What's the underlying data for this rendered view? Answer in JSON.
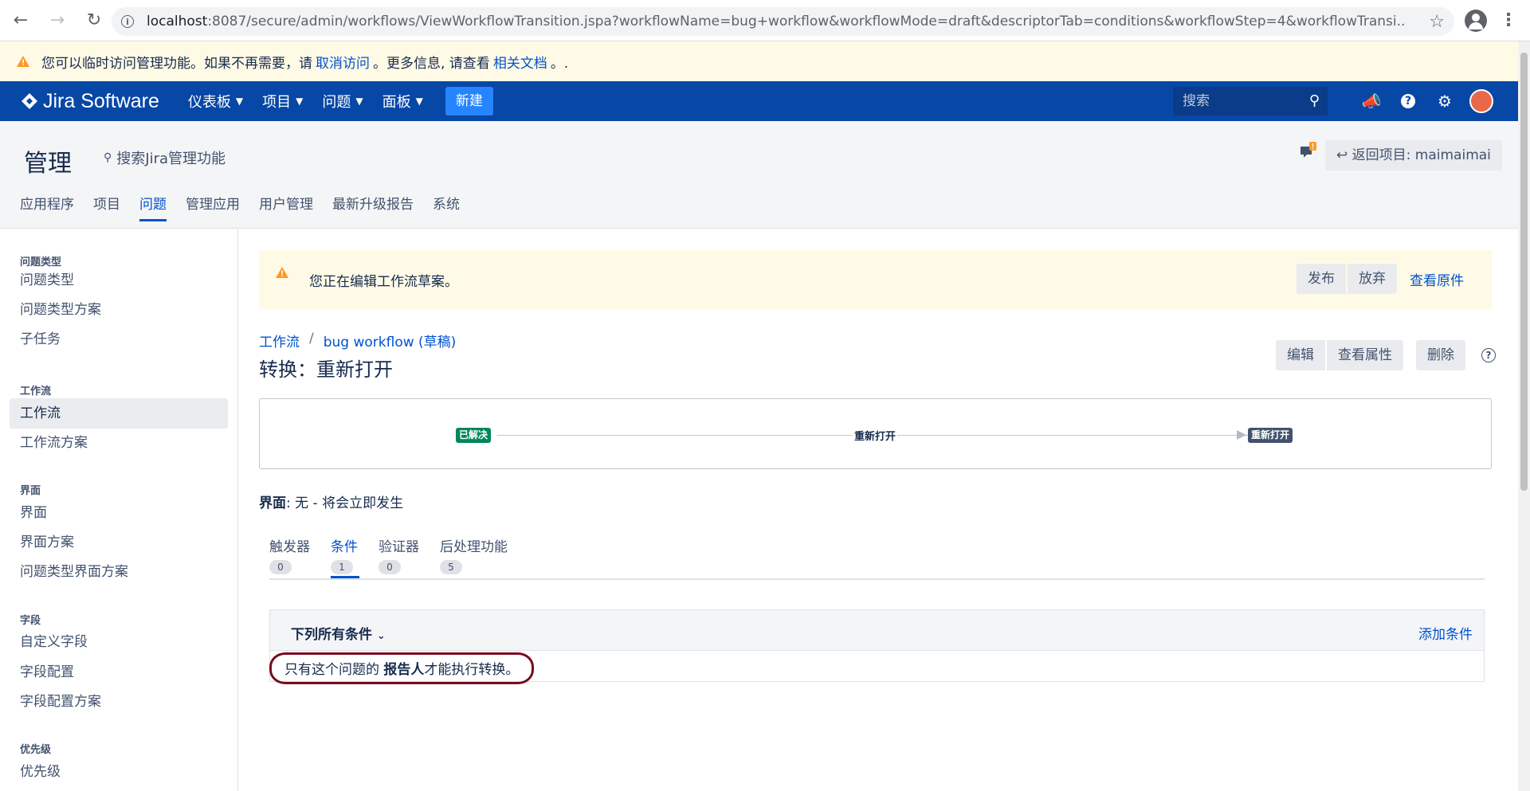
{
  "browser": {
    "url_host": "localhost",
    "url_rest": ":8087/secure/admin/workflows/ViewWorkflowTransition.jspa?workflowName=bug+workflow&workflowMode=draft&descriptorTab=conditions&workflowStep=4&workflowTransi..."
  },
  "banner": {
    "text_before": "您可以临时访问管理功能。如果不再需要，请",
    "link_cancel": "取消访问",
    "text_middle": "。更多信息, 请查看",
    "link_docs": "相关文档",
    "text_after": "。."
  },
  "header": {
    "logo": "Jira Software",
    "menu": [
      "仪表板",
      "项目",
      "问题",
      "面板"
    ],
    "create_label": "新建",
    "search_placeholder": "搜索"
  },
  "admin": {
    "title": "管理",
    "search_label": "搜索Jira管理功能",
    "back_button": "返回项目: maimaimai",
    "tabs": [
      "应用程序",
      "项目",
      "问题",
      "管理应用",
      "用户管理",
      "最新升级报告",
      "系统"
    ],
    "active_tab": "问题"
  },
  "sidebar": {
    "sections": [
      {
        "heading": "问题类型",
        "items": [
          "问题类型",
          "问题类型方案",
          "子任务"
        ]
      },
      {
        "heading": "工作流",
        "items": [
          "工作流",
          "工作流方案"
        ]
      },
      {
        "heading": "界面",
        "items": [
          "界面",
          "界面方案",
          "问题类型界面方案"
        ]
      },
      {
        "heading": "字段",
        "items": [
          "自定义字段",
          "字段配置",
          "字段配置方案"
        ]
      },
      {
        "heading": "优先级",
        "items": [
          "优先级"
        ]
      }
    ],
    "active_item": "工作流"
  },
  "draft_notice": {
    "message": "您正在编辑工作流草案。",
    "publish": "发布",
    "discard": "放弃",
    "view_original": "查看原件"
  },
  "breadcrumb": {
    "root": "工作流",
    "current": "bug workflow (草稿)"
  },
  "page_title": "转换：重新打开",
  "actions": {
    "edit": "编辑",
    "view_properties": "查看属性",
    "delete": "删除"
  },
  "diagram": {
    "from_status": "已解决",
    "transition": "重新打开",
    "to_status": "重新打开",
    "colors": {
      "from": "#00875a",
      "to": "#42526e"
    }
  },
  "screen": {
    "label": "界面",
    "value": ": 无 - 将会立即发生"
  },
  "tabs": [
    {
      "label": "触发器",
      "count": "0"
    },
    {
      "label": "条件",
      "count": "1"
    },
    {
      "label": "验证器",
      "count": "0"
    },
    {
      "label": "后处理功能",
      "count": "5"
    }
  ],
  "active_tab": "条件",
  "conditions": {
    "group_label": "下列所有条件",
    "add_label": "添加条件",
    "text_before": "只有这个问题的",
    "text_bold": "报告人",
    "text_after": "才能执行转换。"
  }
}
